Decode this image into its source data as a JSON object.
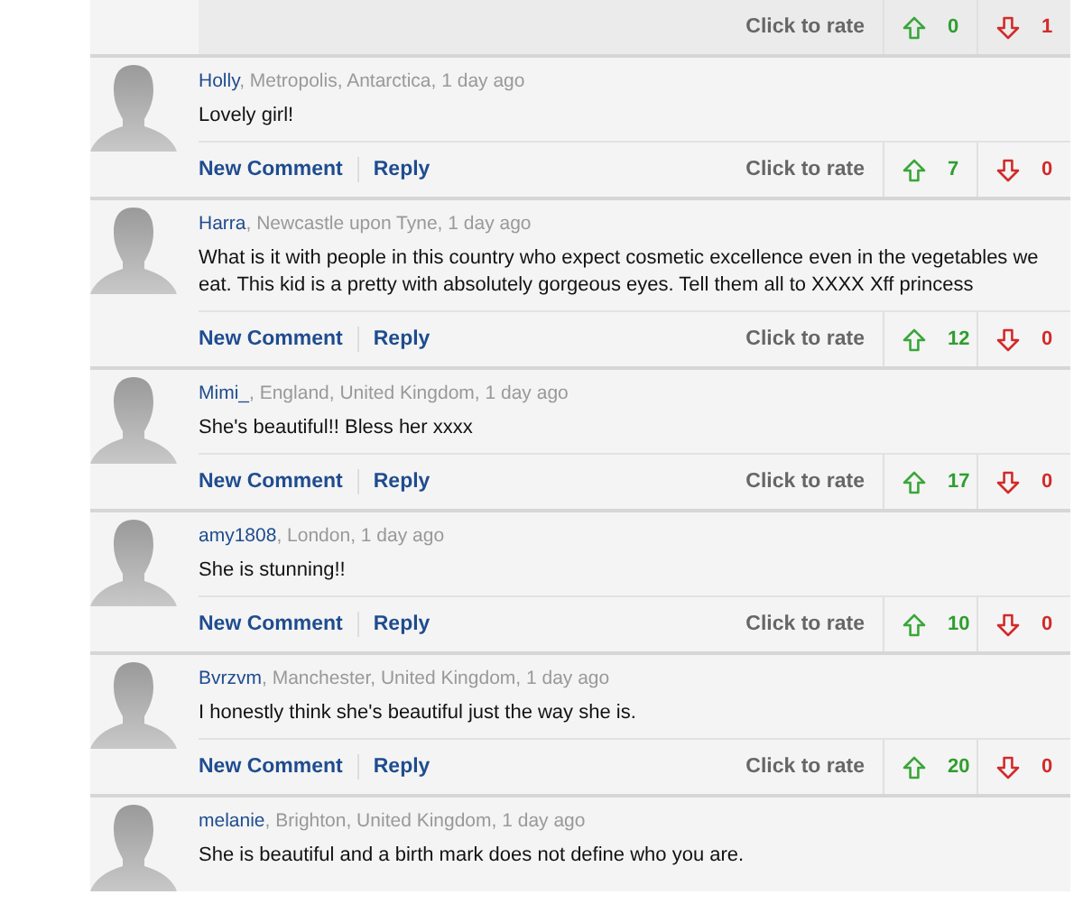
{
  "top_rating": {
    "rate_label": "Click to rate",
    "up_count": "0",
    "down_count": "1"
  },
  "comments": [
    {
      "author": "Holly",
      "details": ", Metropolis, Antarctica, 1 day ago",
      "text": "Lovely girl!",
      "links": [
        "New Comment",
        "Reply"
      ],
      "rate_label": "Click to rate",
      "up_count": "7",
      "down_count": "0"
    },
    {
      "author": "Harra",
      "details": ", Newcastle upon Tyne, 1 day ago",
      "text": "What is it with people in this country who expect cosmetic excellence even in the vegetables we eat. This kid is a pretty with absolutely gorgeous eyes. Tell them all to XXXX Xff princess",
      "links": [
        "New Comment",
        "Reply"
      ],
      "rate_label": "Click to rate",
      "up_count": "12",
      "down_count": "0"
    },
    {
      "author": "Mimi_",
      "details": ", England, United Kingdom, 1 day ago",
      "text": "She's beautiful!! Bless her xxxx",
      "links": [
        "New Comment",
        "Reply"
      ],
      "rate_label": "Click to rate",
      "up_count": "17",
      "down_count": "0"
    },
    {
      "author": "amy1808",
      "details": ", London, 1 day ago",
      "text": "She is stunning!!",
      "links": [
        "New Comment",
        "Reply"
      ],
      "rate_label": "Click to rate",
      "up_count": "10",
      "down_count": "0"
    },
    {
      "author": "Bvrzvm",
      "details": ", Manchester, United Kingdom, 1 day ago",
      "text": "I honestly think she's beautiful just the way she is.",
      "links": [
        "New Comment",
        "Reply"
      ],
      "rate_label": "Click to rate",
      "up_count": "20",
      "down_count": "0"
    },
    {
      "author": "melanie",
      "details": ", Brighton, United Kingdom, 1 day ago",
      "text": "She is beautiful and a birth mark does not define who you are."
    }
  ]
}
